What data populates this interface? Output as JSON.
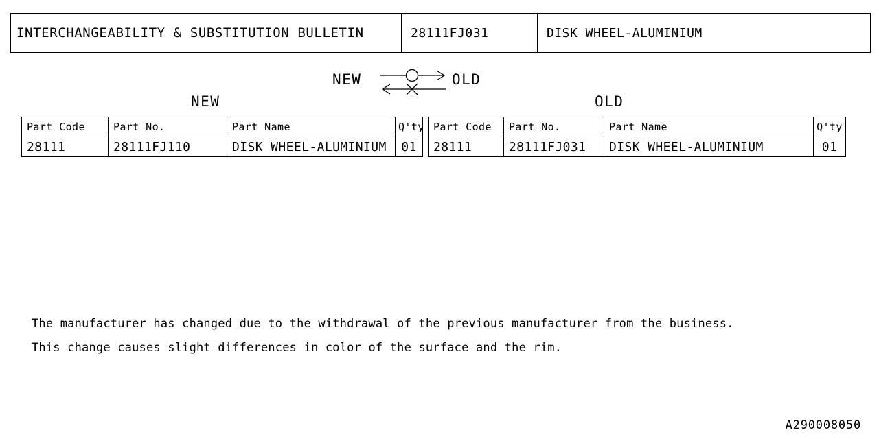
{
  "header": {
    "title": "INTERCHANGEABILITY & SUBSTITUTION BULLETIN",
    "part_number": "28111FJ031",
    "part_name": "DISK WHEEL-ALUMINIUM"
  },
  "symbol": {
    "left_label": "NEW",
    "right_label": "OLD",
    "forward_mark": "circle",
    "reverse_mark": "cross",
    "forward_direction": "new-to-old",
    "reverse_direction": "old-to-new"
  },
  "captions": {
    "new": "NEW",
    "old": "OLD"
  },
  "table": {
    "columns": [
      "Part Code",
      "Part No.",
      "Part Name",
      "Q'ty"
    ],
    "new_rows": [
      {
        "part_code": "28111",
        "part_no": "28111FJ110",
        "part_name": "DISK WHEEL-ALUMINIUM",
        "qty": "01"
      }
    ],
    "old_rows": [
      {
        "part_code": "28111",
        "part_no": "28111FJ031",
        "part_name": "DISK WHEEL-ALUMINIUM",
        "qty": "01"
      }
    ]
  },
  "notes": [
    "The manufacturer has changed due to the withdrawal of the previous manufacturer from the business.",
    "This change causes slight differences in color of the surface and the rim."
  ],
  "footer": {
    "document_code": "A290008050"
  },
  "colors": {
    "ink": "#000000",
    "paper": "#ffffff"
  }
}
